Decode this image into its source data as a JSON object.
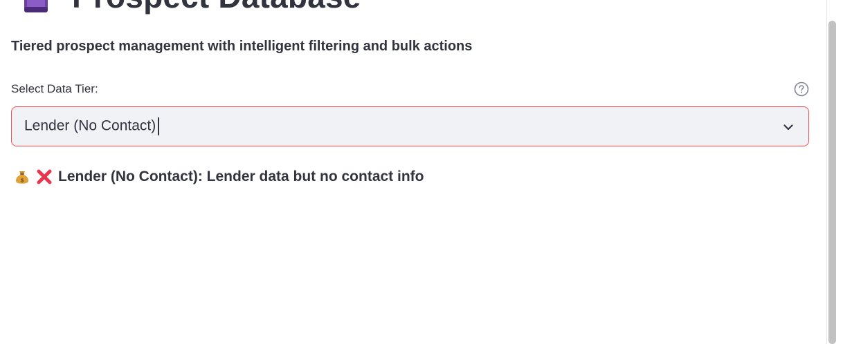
{
  "header": {
    "title": "Prospect Database",
    "title_icon": "book-icon",
    "subtitle": "Tiered prospect management with intelligent filtering and bulk actions"
  },
  "tier_select": {
    "label": "Select Data Tier:",
    "help_icon": "help-circle-icon",
    "selected_value": "Lender (No Contact)",
    "dropdown_icon": "chevron-down-icon",
    "accent_border_color": "#ff4b4b"
  },
  "tier_info": {
    "icons": [
      "money-bag-icon",
      "red-x-icon"
    ],
    "text": "Lender (No Contact): Lender data but no contact info"
  }
}
